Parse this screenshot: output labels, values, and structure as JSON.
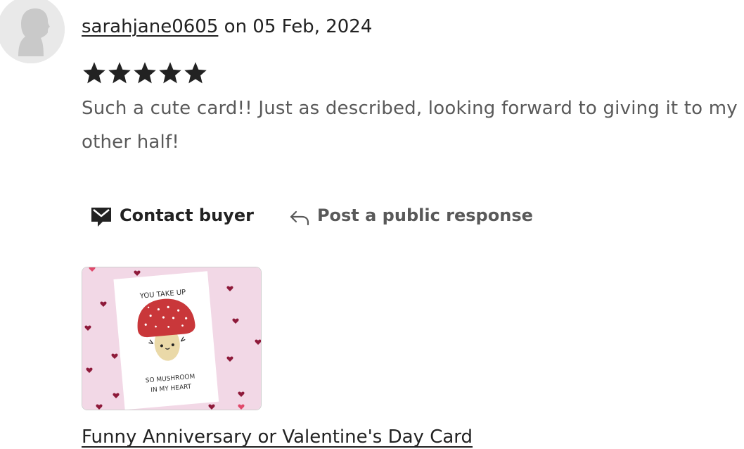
{
  "review": {
    "username": "sarahjane0605",
    "date_text": "on 05 Feb, 2024",
    "rating": 5,
    "max_rating": 5,
    "text": "Such a cute card!! Just as described, looking forward to giving it to my other half!"
  },
  "actions": {
    "contact_label": "Contact buyer",
    "reply_label": "Post a public response"
  },
  "product": {
    "card_text_top": "YOU TAKE UP",
    "card_text_bottom_1": "SO MUSHROOM",
    "card_text_bottom_2": "IN MY HEART",
    "title": "Funny Anniversary or Valentine's Day Card"
  },
  "colors": {
    "star": "#222222",
    "card_background": "#f2d8e6",
    "mushroom_cap": "#c9373a",
    "heart": "#8e1a3a"
  }
}
